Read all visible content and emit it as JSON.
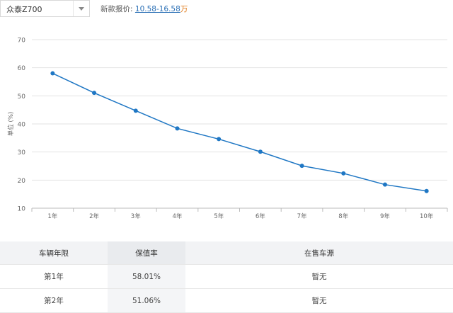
{
  "selector": {
    "value": "众泰Z700",
    "arrow_icon": "chevron-down-icon"
  },
  "price": {
    "label": "新款报价:",
    "range": "10.58-16.58",
    "unit": "万"
  },
  "chart_data": {
    "type": "line",
    "categories": [
      "1年",
      "2年",
      "3年",
      "4年",
      "5年",
      "6年",
      "7年",
      "8年",
      "9年",
      "10年"
    ],
    "series": [
      {
        "values": [
          58.01,
          51.06,
          44.7,
          38.4,
          34.6,
          30.1,
          25.1,
          22.4,
          18.4,
          16.1
        ]
      }
    ],
    "ylabel": "单位 (%)",
    "yticks": [
      10,
      20,
      30,
      40,
      50,
      60,
      70
    ],
    "ylim": [
      10,
      70
    ],
    "grid": true,
    "color": "#1f77c4"
  },
  "table": {
    "headers": [
      "车辆年限",
      "保值率",
      "在售车源"
    ],
    "rows": [
      [
        "第1年",
        "58.01%",
        "暂无"
      ],
      [
        "第2年",
        "51.06%",
        "暂无"
      ]
    ]
  }
}
